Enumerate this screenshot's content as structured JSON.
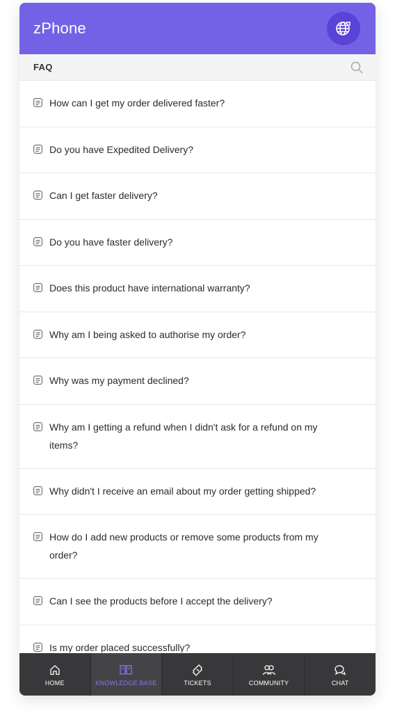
{
  "app": {
    "title": "zPhone"
  },
  "colors": {
    "header": "#7362e5",
    "globe_button": "#5a43d6",
    "nav_bg": "#38383a",
    "nav_active": "#8777f0"
  },
  "subbar": {
    "label": "FAQ"
  },
  "faqs": [
    "How can I get my order delivered faster?",
    "Do you have Expedited Delivery?",
    "Can I get faster delivery?",
    "Do you have faster delivery?",
    "Does this product have international warranty?",
    "Why am I being asked to authorise my order?",
    "Why was my payment declined?",
    "Why am I getting a refund when I didn't ask for a refund on my items?",
    "Why didn't I receive an email about my order getting shipped?",
    "How do I add new products or remove some products from my order?",
    "Can I see the products before I accept the delivery?",
    "Is my order placed successfully?"
  ],
  "nav": [
    {
      "label": "HOME",
      "icon": "home-icon"
    },
    {
      "label": "KNOWLEDGE BASE",
      "icon": "book-icon",
      "active": true
    },
    {
      "label": "TICKETS",
      "icon": "ticket-icon"
    },
    {
      "label": "COMMUNITY",
      "icon": "community-icon"
    },
    {
      "label": "CHAT",
      "icon": "chat-icon"
    }
  ]
}
